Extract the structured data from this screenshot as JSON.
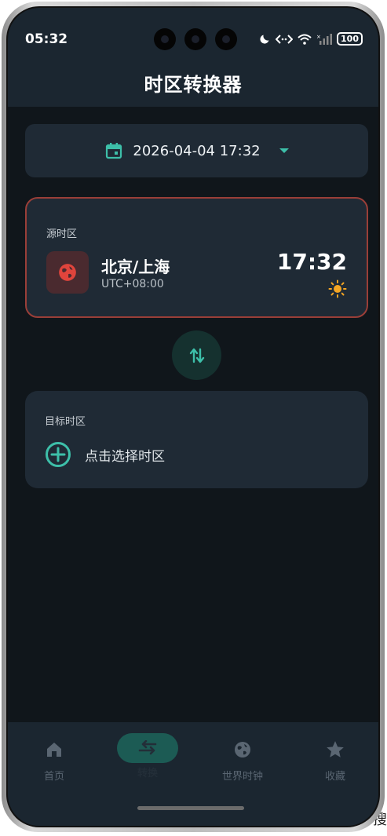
{
  "status_bar": {
    "time": "05:32",
    "battery": "100"
  },
  "header": {
    "title": "时区转换器"
  },
  "date_picker": {
    "value": "2026-04-04 17:32"
  },
  "source": {
    "label": "源时区",
    "city": "北京/上海",
    "utc_offset": "UTC+08:00",
    "time": "17:32"
  },
  "target": {
    "label": "目标时区",
    "add_text": "点击选择时区"
  },
  "nav": {
    "items": [
      {
        "label": "首页",
        "icon": "home-icon"
      },
      {
        "label": "转换",
        "icon": "swap-icon"
      },
      {
        "label": "世界时钟",
        "icon": "globe-icon"
      },
      {
        "label": "收藏",
        "icon": "star-icon"
      }
    ],
    "active_index": 1
  },
  "side_text": "搜",
  "colors": {
    "accent": "#3dbfa9",
    "header_bg": "#1b2630",
    "card_bg": "#1f2a35",
    "source_border": "#9a3e38",
    "globe_red": "#e0443c",
    "sun_orange": "#f5a623"
  }
}
